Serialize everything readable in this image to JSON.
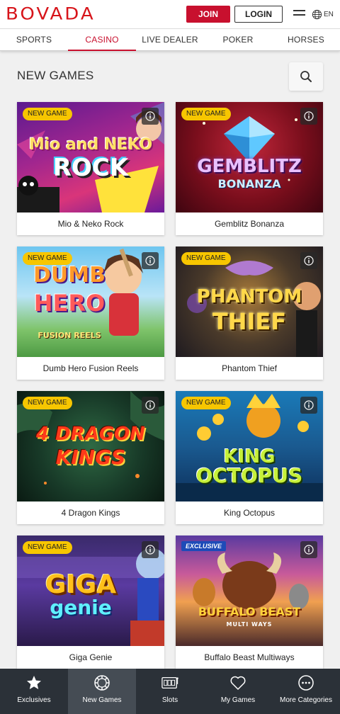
{
  "header": {
    "logo_text": "BOVADA",
    "join_label": "JOIN",
    "login_label": "LOGIN",
    "language": "EN",
    "menu_icon": "hamburger-icon",
    "globe_icon": "globe-icon"
  },
  "nav": {
    "tabs": [
      {
        "label": "SPORTS"
      },
      {
        "label": "CASINO"
      },
      {
        "label": "LIVE DEALER"
      },
      {
        "label": "POKER"
      },
      {
        "label": "HORSES"
      }
    ],
    "active": "CASINO"
  },
  "main": {
    "title": "NEW GAMES",
    "search_icon": "search-icon"
  },
  "games": [
    {
      "name": "Mio & Neko Rock",
      "badge": "NEW GAME",
      "logo_line1": "Mio and NEKO",
      "logo_line2": "ROCK"
    },
    {
      "name": "Gemblitz Bonanza",
      "badge": "NEW GAME",
      "logo_line1": "GEMBLITZ",
      "logo_line2": "BONANZA"
    },
    {
      "name": "Dumb Hero Fusion Reels",
      "badge": "NEW GAME",
      "logo_line1": "DUMB",
      "logo_line2": "HERO",
      "logo_line3": "FUSION REELS"
    },
    {
      "name": "Phantom Thief",
      "badge": "NEW GAME",
      "logo_line1": "PHANTOM",
      "logo_line2": "THIEF"
    },
    {
      "name": "4 Dragon Kings",
      "badge": "NEW GAME",
      "logo_line1": "4 DRAGON",
      "logo_line2": "KINGS"
    },
    {
      "name": "King Octopus",
      "badge": "NEW GAME",
      "logo_line1": "KING",
      "logo_line2": "OCTOPUS"
    },
    {
      "name": "Giga Genie",
      "badge": "NEW GAME",
      "logo_line1": "GIGA",
      "logo_line2": "genie"
    },
    {
      "name": "Buffalo Beast Multiways",
      "badge": "EXCLUSIVE",
      "logo_line1": "BUFFALO BEAST",
      "logo_line2": "MULTI WAYS"
    }
  ],
  "bottom_nav": [
    {
      "label": "Exclusives",
      "icon": "star-icon"
    },
    {
      "label": "New Games",
      "icon": "chip-icon"
    },
    {
      "label": "Slots",
      "icon": "slot-machine-icon"
    },
    {
      "label": "My Games",
      "icon": "heart-icon"
    },
    {
      "label": "More Categories",
      "icon": "more-icon"
    }
  ],
  "colors": {
    "brand_red": "#c8102e",
    "badge_yellow": "#f7c600",
    "bottom_nav_bg": "#2b3138"
  }
}
